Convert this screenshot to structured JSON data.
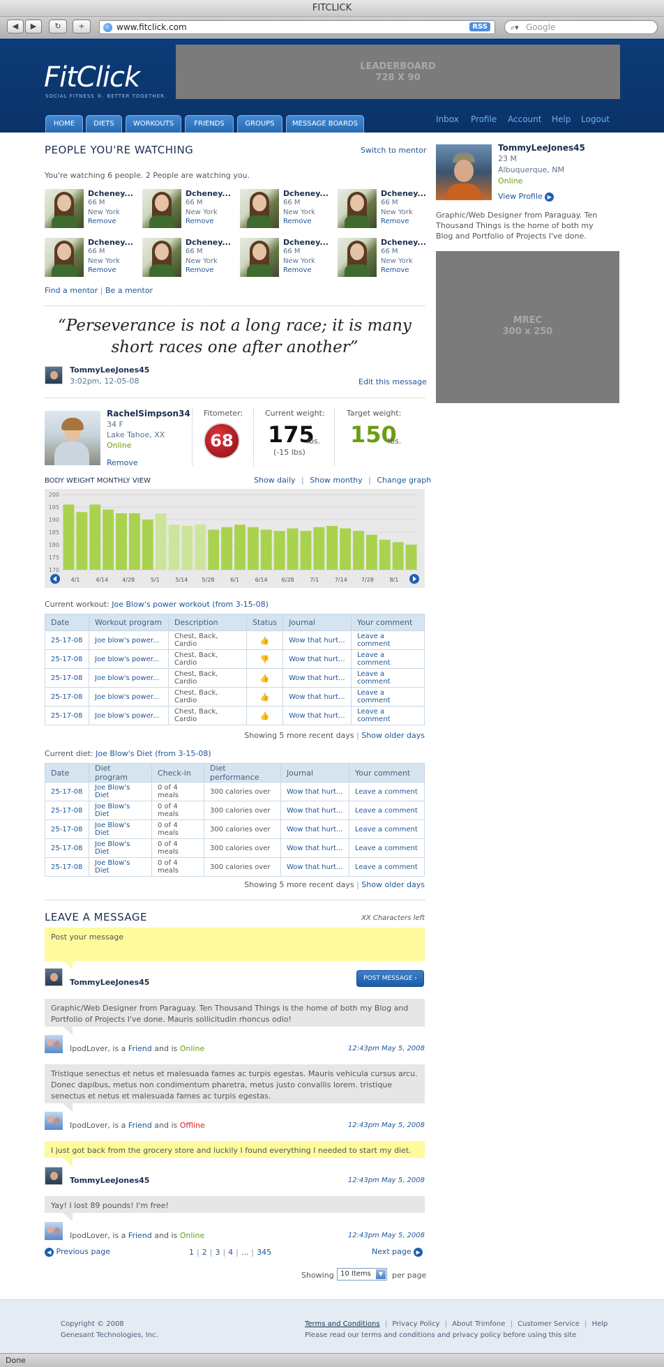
{
  "browser": {
    "title": "FITCLICK",
    "back": "◀",
    "forward": "▶",
    "reload": "↻",
    "add": "+",
    "url": "www.fitclick.com",
    "rss": "RSS",
    "search_placeholder": "Google",
    "status": "Done"
  },
  "header": {
    "logo": "FitClick",
    "tagline": "SOCIAL FITNESS ®. BETTER TOGETHER.",
    "leaderboard_line1": "LEADERBOARD",
    "leaderboard_line2": "728 X 90",
    "tabs": [
      "HOME",
      "DIETS",
      "WORKOUTS",
      "FRIENDS",
      "GROUPS",
      "MESSAGE BOARDS"
    ],
    "user_nav": [
      "Inbox",
      "Profile",
      "Account",
      "Help",
      "Logout"
    ]
  },
  "watching": {
    "title": "PEOPLE YOU'RE WATCHING",
    "switch_link": "Switch to mentor",
    "summary": "You're watching 6 people. 2 People are watching you.",
    "people": [
      {
        "name": "Dcheney...",
        "info": "66 M",
        "city": "New York",
        "action": "Remove"
      },
      {
        "name": "Dcheney...",
        "info": "66 M",
        "city": "New York",
        "action": "Remove"
      },
      {
        "name": "Dcheney...",
        "info": "66 M",
        "city": "New York",
        "action": "Remove"
      },
      {
        "name": "Dcheney...",
        "info": "66 M",
        "city": "New York",
        "action": "Remove"
      },
      {
        "name": "Dcheney...",
        "info": "66 M",
        "city": "New York",
        "action": "Remove"
      },
      {
        "name": "Dcheney...",
        "info": "66 M",
        "city": "New York",
        "action": "Remove"
      },
      {
        "name": "Dcheney...",
        "info": "66 M",
        "city": "New York",
        "action": "Remove"
      },
      {
        "name": "Dcheney...",
        "info": "66 M",
        "city": "New York",
        "action": "Remove"
      }
    ],
    "find_mentor": "Find a mentor",
    "sep": "|",
    "be_mentor": "Be a mentor"
  },
  "quote": {
    "text": "“Perseverance is not a long race; it is many short races one after another”",
    "author": "TommyLeeJones45",
    "timestamp": "3:02pm, 12-05-08",
    "edit": "Edit this message"
  },
  "member": {
    "name": "RachelSimpson34",
    "info": "34 F",
    "city": "Lake Tahoe, XX",
    "status": "Online",
    "remove": "Remove",
    "fitometer_label": "Fitometer:",
    "fitometer_value": "68",
    "current_label": "Current weight:",
    "current_value": "175",
    "current_unit": "lbs.",
    "current_delta": "(-15 lbs)",
    "target_label": "Target weight:",
    "target_value": "150",
    "target_unit": "lbs."
  },
  "chart_section": {
    "title": "BODY WEIGHT MONTHLY VIEW",
    "show_daily": "Show daily",
    "show_monthly": "Show monthy",
    "change_graph": "Change graph",
    "sep": "|"
  },
  "chart_data": {
    "type": "bar",
    "title": "BODY WEIGHT MONTHLY VIEW",
    "ylim": [
      170,
      200
    ],
    "yticks": [
      200,
      195,
      190,
      185,
      180,
      175,
      170
    ],
    "x_tick_labels": [
      "4/1",
      "4/14",
      "4/28",
      "5/1",
      "5/14",
      "5/28",
      "6/1",
      "6/14",
      "6/28",
      "7/1",
      "7/14",
      "7/28",
      "8/1"
    ],
    "values": [
      196,
      193,
      196,
      194,
      192.5,
      192.5,
      190,
      192.5,
      188,
      187.5,
      188,
      186,
      187,
      188,
      187,
      186,
      185.5,
      186.5,
      185.5,
      187,
      187.5,
      186.5,
      185.5,
      184,
      182,
      181,
      180
    ],
    "highlight_indices": [
      7,
      8,
      9,
      10
    ],
    "grid": true,
    "colors": {
      "bar": "#a9d34f",
      "bar_light": "#cde59b",
      "background": "#e9e9e9"
    }
  },
  "workout": {
    "current_label": "Current workout:",
    "current_link": "Joe Blow's power workout (from 3-15-08)",
    "columns": [
      "Date",
      "Workout program",
      "Description",
      "Status",
      "Journal",
      "Your comment"
    ],
    "rows": [
      {
        "date": "25-17-08",
        "program": "Joe blow's power...",
        "desc": "Chest, Back, Cardio",
        "status": "thumbs-up",
        "journal": "Wow that hurt...",
        "comment": "Leave a comment"
      },
      {
        "date": "25-17-08",
        "program": "Joe blow's power...",
        "desc": "Chest, Back, Cardio",
        "status": "thumbs-down",
        "journal": "Wow that hurt...",
        "comment": "Leave a comment"
      },
      {
        "date": "25-17-08",
        "program": "Joe blow's power...",
        "desc": "Chest, Back, Cardio",
        "status": "thumbs-up",
        "journal": "Wow that hurt...",
        "comment": "Leave a comment"
      },
      {
        "date": "25-17-08",
        "program": "Joe blow's power...",
        "desc": "Chest, Back, Cardio",
        "status": "thumbs-up",
        "journal": "Wow that hurt...",
        "comment": "Leave a comment"
      },
      {
        "date": "25-17-08",
        "program": "Joe blow's power...",
        "desc": "Chest, Back, Cardio",
        "status": "thumbs-up",
        "journal": "Wow that hurt...",
        "comment": "Leave a comment"
      }
    ],
    "showing": "Showing 5 more recent days",
    "sep": "|",
    "older": "Show older days"
  },
  "diet": {
    "current_label": "Current diet:",
    "current_link": "Joe Blow's Diet (from 3-15-08)",
    "columns": [
      "Date",
      "Diet program",
      "Check-in",
      "Diet performance",
      "Journal",
      "Your comment"
    ],
    "rows": [
      {
        "date": "25-17-08",
        "program": "Joe Blow's Diet",
        "checkin": "0 of 4 meals",
        "perf": "300 calories over",
        "journal": "Wow that hurt...",
        "comment": "Leave a comment"
      },
      {
        "date": "25-17-08",
        "program": "Joe Blow's Diet",
        "checkin": "0 of 4 meals",
        "perf": "300 calories over",
        "journal": "Wow that hurt...",
        "comment": "Leave a comment"
      },
      {
        "date": "25-17-08",
        "program": "Joe Blow's Diet",
        "checkin": "0 of 4 meals",
        "perf": "300 calories over",
        "journal": "Wow that hurt...",
        "comment": "Leave a comment"
      },
      {
        "date": "25-17-08",
        "program": "Joe Blow's Diet",
        "checkin": "0 of 4 meals",
        "perf": "300 calories over",
        "journal": "Wow that hurt...",
        "comment": "Leave a comment"
      },
      {
        "date": "25-17-08",
        "program": "Joe Blow's Diet",
        "checkin": "0 of 4 meals",
        "perf": "300 calories over",
        "journal": "Wow that hurt...",
        "comment": "Leave a comment"
      }
    ],
    "showing": "Showing 5 more recent days",
    "sep": "|",
    "older": "Show older days"
  },
  "messages": {
    "title": "LEAVE A MESSAGE",
    "chars_left": "XX Characters left",
    "placeholder": "Post your message",
    "poster": "TommyLeeJones45",
    "post_button": "POST MESSAGE ›",
    "items": [
      {
        "text": "Graphic/Web Designer from Paraguay. Ten Thousand Things is the home of both my Blog and Portfolio of Projects I've done. Mauris sollicitudin rhoncus odio!",
        "user": "IpodLover",
        "mid1": ", is a ",
        "rel": "Friend",
        "mid2": " and is ",
        "state": "Online",
        "time": "12:43pm May 5, 2008"
      },
      {
        "text": "Tristique senectus et netus et malesuada fames ac turpis egestas. Mauris vehicula cursus arcu. Donec dapibus, metus non condimentum pharetra, metus justo convallis lorem. tristique senectus et netus et malesuada fames ac turpis egestas.",
        "user": "IpodLover",
        "mid1": ", is a ",
        "rel": "Friend",
        "mid2": " and is ",
        "state": "Offline",
        "time": "12:43pm May 5, 2008"
      },
      {
        "text": "I just got back from the grocery store and luckily I found everything I needed to start my diet.",
        "user": "TommyLeeJones45",
        "time": "12:43pm May 5, 2008"
      },
      {
        "text": "Yay! I lost 89 pounds! I'm free!",
        "user": "IpodLover",
        "mid1": ", is a ",
        "rel": "Friend",
        "mid2": " and is ",
        "state": "Online",
        "time": "12:43pm May 5, 2008"
      }
    ]
  },
  "pagination": {
    "prev": "Previous page",
    "next": "Next page",
    "pages": [
      "1",
      "2",
      "3",
      "4",
      "...",
      "345"
    ],
    "sep": "|",
    "showing": "Showing",
    "select_value": "10 Items",
    "per_page": "per page"
  },
  "profile_card": {
    "name": "TommyLeeJones45",
    "info": "23 M",
    "city": "Albuquerque, NM",
    "status": "Online",
    "view_profile": "View Profile",
    "bio": "Graphic/Web Designer from Paraguay. Ten Thousand Things is the home of both my Blog and Portfolio of Projects I've done.",
    "mrec_line1": "MREC",
    "mrec_line2": "300 x 250"
  },
  "footer": {
    "copyright": "Copyright © 2008",
    "company": "Genesant Technologies, Inc.",
    "links": [
      "Terms and Conditions",
      "Privacy Policy",
      "About Trimfone",
      "Customer Service",
      "Help"
    ],
    "sep": "|",
    "note": "Please read our terms and conditions and privacy policy before using this site"
  },
  "colors": {
    "header_blue": "#0d3c77",
    "link_blue": "#1e5596",
    "online_green": "#6a9e10",
    "offline_red": "#dd2222",
    "fitometer_red": "#b5121b",
    "target_green": "#6a9e10"
  }
}
